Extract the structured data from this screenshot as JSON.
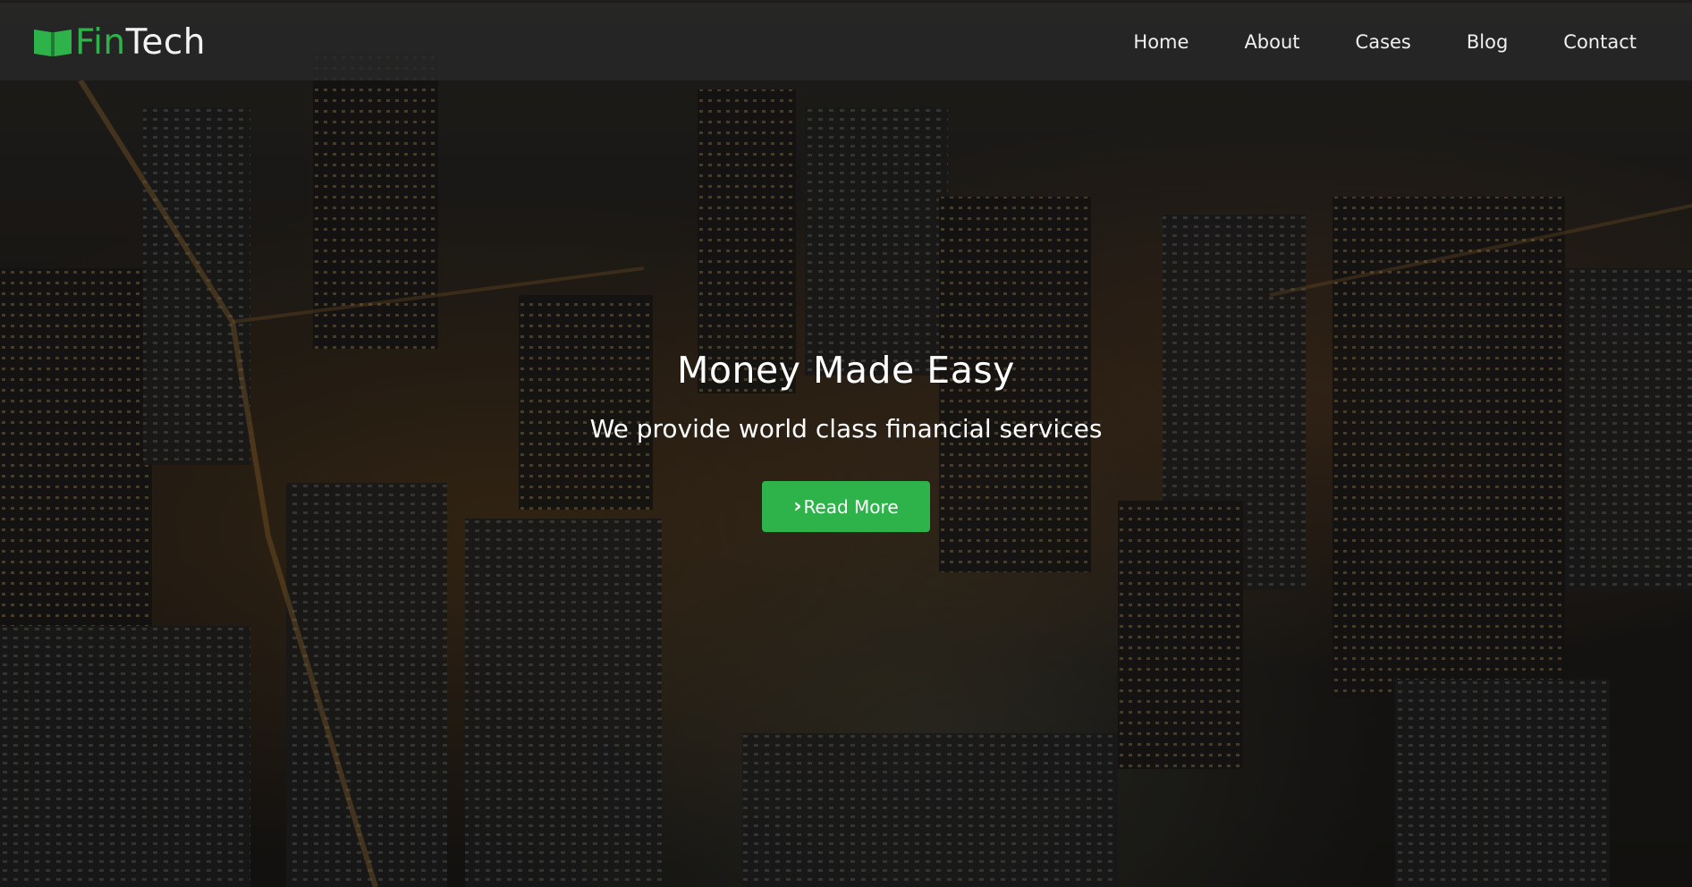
{
  "brand": {
    "name_part1": "Fin",
    "name_part2": "Tech",
    "icon": "book-icon",
    "accent_color": "#2eb34a"
  },
  "nav": {
    "items": [
      "Home",
      "About",
      "Cases",
      "Blog",
      "Contact"
    ]
  },
  "hero": {
    "title": "Money Made Easy",
    "subtitle": "We provide world class financial services",
    "cta_label": "Read More",
    "cta_icon": "chevron-right-icon",
    "background": "night-city-skyline-image"
  }
}
